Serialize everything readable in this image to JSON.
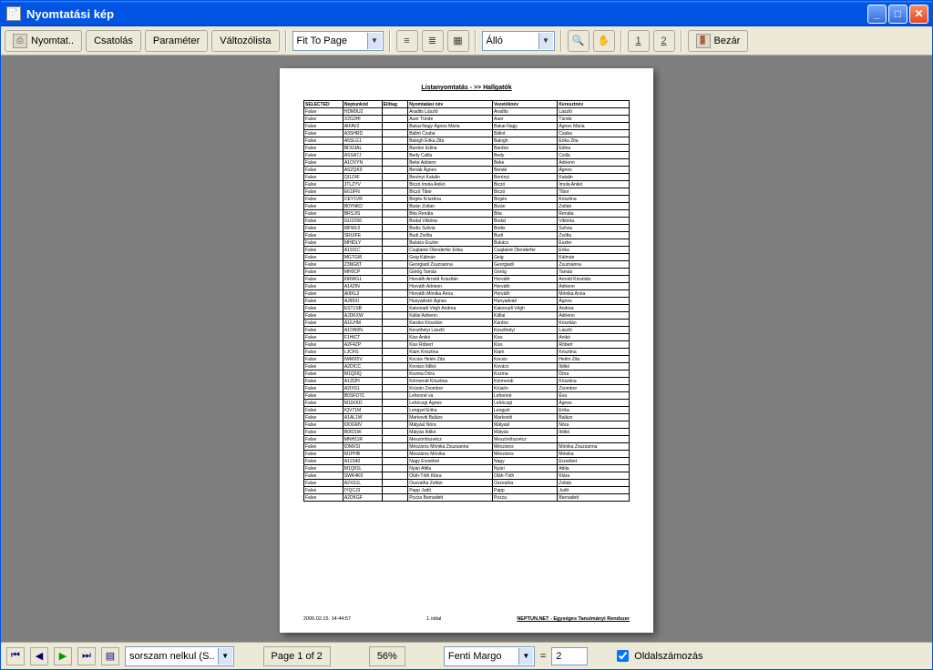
{
  "window": {
    "title": "Nyomtatási kép"
  },
  "toolbar": {
    "print": "Nyomtat..",
    "attach": "Csatolás",
    "param": "Paraméter",
    "changelist": "Változólista",
    "fit": "Fit To Page",
    "orient": "Álló",
    "page1": "1",
    "page2": "2",
    "close": "Bezár"
  },
  "report": {
    "title": "Listanyomtatás - >> Hallgatók",
    "headers": [
      "SELECTED",
      "Neptunkód",
      "Előtag",
      "Nyomtatási név",
      "Vezetéknév",
      "Keresztnév"
    ],
    "rows": [
      [
        "False",
        "HDM9U2",
        "",
        "Aradits László",
        "Aradits",
        "László"
      ],
      [
        "False",
        "X2G3HI",
        "",
        "Auer Tünde",
        "Auer",
        "Tünde"
      ],
      [
        "False",
        "AIFAV2",
        "",
        "Bakai-Nagy Ágnes Mária",
        "Bakai-Nagy",
        "Ágnes Mária"
      ],
      [
        "False",
        "A3SHRD",
        "",
        "Bálint Csaba",
        "Bálint",
        "Csaba"
      ],
      [
        "False",
        "A5SLG1",
        "",
        "Balogh Erika Zita",
        "Balogh",
        "Erika Zita"
      ],
      [
        "False",
        "BDU3AL",
        "",
        "Bardon Edina",
        "Bardon",
        "Edina"
      ],
      [
        "False",
        "ASSA7J",
        "",
        "Bedy Csilla",
        "Bedy",
        "Csilla"
      ],
      [
        "False",
        "A1OVYN",
        "",
        "Beke Adrienn",
        "Beke",
        "Adrienn"
      ],
      [
        "False",
        "ASZQK0",
        "",
        "Benák Ágnes",
        "Benák",
        "Ágnes"
      ],
      [
        "False",
        "QI1Z4F",
        "",
        "Berényi Katalin",
        "Berényi",
        "Katalin"
      ],
      [
        "False",
        "JTLZYV",
        "",
        "Biczó Imola Anikó",
        "Biczó",
        "Imola Anikó"
      ],
      [
        "False",
        "E61IFN",
        "",
        "Biczó Tibor",
        "Biczó",
        "Tibor"
      ],
      [
        "False",
        "CEY1VR",
        "",
        "Birgés Krisztina",
        "Birgés",
        "Krisztina"
      ],
      [
        "False",
        "B0YNKD",
        "",
        "Bizán Zoltán",
        "Bizán",
        "Zoltán"
      ],
      [
        "False",
        "BRSJIS",
        "",
        "Bita Renáta",
        "Bita",
        "Renáta"
      ],
      [
        "False",
        "GU10S6",
        "",
        "Bodal Viktória",
        "Bodal",
        "Viktória"
      ],
      [
        "False",
        "I8FWL0",
        "",
        "Bodis Szilvia",
        "Bodis",
        "Szilvia"
      ],
      [
        "False",
        "SRUIFE",
        "",
        "Budi Zsófia",
        "Budi",
        "Zsófia"
      ],
      [
        "False",
        "MHIDLY",
        "",
        "Bukács Eszter",
        "Bukács",
        "Eszter"
      ],
      [
        "False",
        "A19J1C",
        "",
        "Csajtainé Olenderfer Erika",
        "Csajtainé Olenderfer",
        "Erika"
      ],
      [
        "False",
        "MGTGI8",
        "",
        "Geig Kálmán",
        "Geig",
        "Kálmán"
      ],
      [
        "False",
        "Z3NG8T",
        "",
        "Georgiadi Zsuzsanna",
        "Georgiadi",
        "Zsuzsanna"
      ],
      [
        "False",
        "MH0CP",
        "",
        "Görög Tamás",
        "Görög",
        "Tamás"
      ],
      [
        "False",
        "I0RWG1",
        "",
        "Horváth Arnold Krisztián",
        "Horváth",
        "Arnold Krisztián"
      ],
      [
        "False",
        "A14ZIN",
        "",
        "Horváth Adrienn",
        "Horváth",
        "Adrienn"
      ],
      [
        "False",
        "A0IKL3",
        "",
        "Horváth Mónika Anna",
        "Horváth",
        "Mónika Anna"
      ],
      [
        "False",
        "AJ95XI",
        "",
        "Hunyadvári Ágnes",
        "Hunyadvári",
        "Ágnes"
      ],
      [
        "False",
        "EST1SB",
        "",
        "Kakonadi Végh Andrea",
        "Kakonadi Végh",
        "Andrea"
      ],
      [
        "False",
        "AJDKXW",
        "",
        "Kállai Adrienn",
        "Kállai",
        "Adrienn"
      ],
      [
        "False",
        "A1ILHM",
        "",
        "Kardos Krisztián",
        "Kardos",
        "Krisztián"
      ],
      [
        "False",
        "A1ON0N",
        "",
        "Keszthelyi László",
        "Keszthelyi",
        "László"
      ],
      [
        "False",
        "F1HICT",
        "",
        "Kiss Anikó",
        "Kiss",
        "Anikó"
      ],
      [
        "False",
        "A2F4ZP",
        "",
        "Kiss Róbert",
        "Kiss",
        "Róbert"
      ],
      [
        "False",
        "LJCFG",
        "",
        "Klam Krisztina",
        "Klam",
        "Krisztina"
      ],
      [
        "False",
        "IWMX5V",
        "",
        "Kocsis Helén Zita",
        "Kocsis",
        "Helén Zita"
      ],
      [
        "False",
        "A2DICC",
        "",
        "Kovács Ildikó",
        "Kovács",
        "Ildikó"
      ],
      [
        "False",
        "M1Q0IQ",
        "",
        "Kozma Dóra",
        "Kozma",
        "Dóra"
      ],
      [
        "False",
        "A1ZI2H",
        "",
        "Körmendi Krisztina",
        "Körmendi",
        "Krisztina"
      ],
      [
        "False",
        "A2IXS1",
        "",
        "Krüsón Zsombor",
        "Krüsón",
        "Zsombor"
      ],
      [
        "False",
        "B0SFD7C",
        "",
        "Lehonné va",
        "Lehonné",
        "Éva"
      ],
      [
        "False",
        "M11KKD",
        "",
        "Lehóczgi Ágnes",
        "Lehóczgi",
        "Ágnes"
      ],
      [
        "False",
        "IQV71M",
        "",
        "Lengyel Erika",
        "Lengyel",
        "Erika"
      ],
      [
        "False",
        "A1AL1W",
        "",
        "Markoviti Balázs",
        "Markoviti",
        "Balázs"
      ],
      [
        "False",
        "I0OGMV",
        "",
        "Mátyásl Nóra",
        "Mátyásl",
        "Nóra"
      ],
      [
        "False",
        "B0ID1W",
        "",
        "Mátyás Ildikó",
        "Mátyás",
        "Ildikó"
      ],
      [
        "False",
        "MNH11R",
        "",
        "Meszörölszvécz",
        "Meszörölszvécz",
        ""
      ],
      [
        "False",
        "IDMXSI",
        "",
        "Mészáros Mónika Zsuzsanna",
        "Mészáros",
        "Mónika Zsuzsanna"
      ],
      [
        "False",
        "M1PHB",
        "",
        "Mészáros Mónika",
        "Mészáros",
        "Mónika"
      ],
      [
        "False",
        "A11S40",
        "",
        "Nagy Erzsébet",
        "Nagy",
        "Erzsébet"
      ],
      [
        "False",
        "M1Q01L",
        "",
        "Nyári Attila",
        "Nyári",
        "Attila"
      ],
      [
        "False",
        "SWK4K9",
        "",
        "Oláh-Tóth Klára",
        "Oláh-Tóth",
        "Klára"
      ],
      [
        "False",
        "A2XS1L",
        "",
        "Oszvatha Zoltán",
        "Oszvatha",
        "Zoltán"
      ],
      [
        "False",
        "IYQCJ3",
        "",
        "Papp Judit",
        "Papp",
        "Judit"
      ],
      [
        "False",
        "A2DKGF",
        "",
        "Pozza Bernadett",
        "Pozza",
        "Bernadett"
      ]
    ],
    "footer_left": "2006.02.15. 14:44:57",
    "footer_center": "1.oldal",
    "footer_right": "NEPTUN.NET - Egységes Tanulmányi Rendszer"
  },
  "status": {
    "sort_combo": "sorszam nelkul  (S..",
    "page_of": "Page 1 of 2",
    "zoom": "56%",
    "margin_combo": "Fenti Margo",
    "eq": "=",
    "margin_val": "2",
    "numbering": "Oldalszámozás"
  }
}
